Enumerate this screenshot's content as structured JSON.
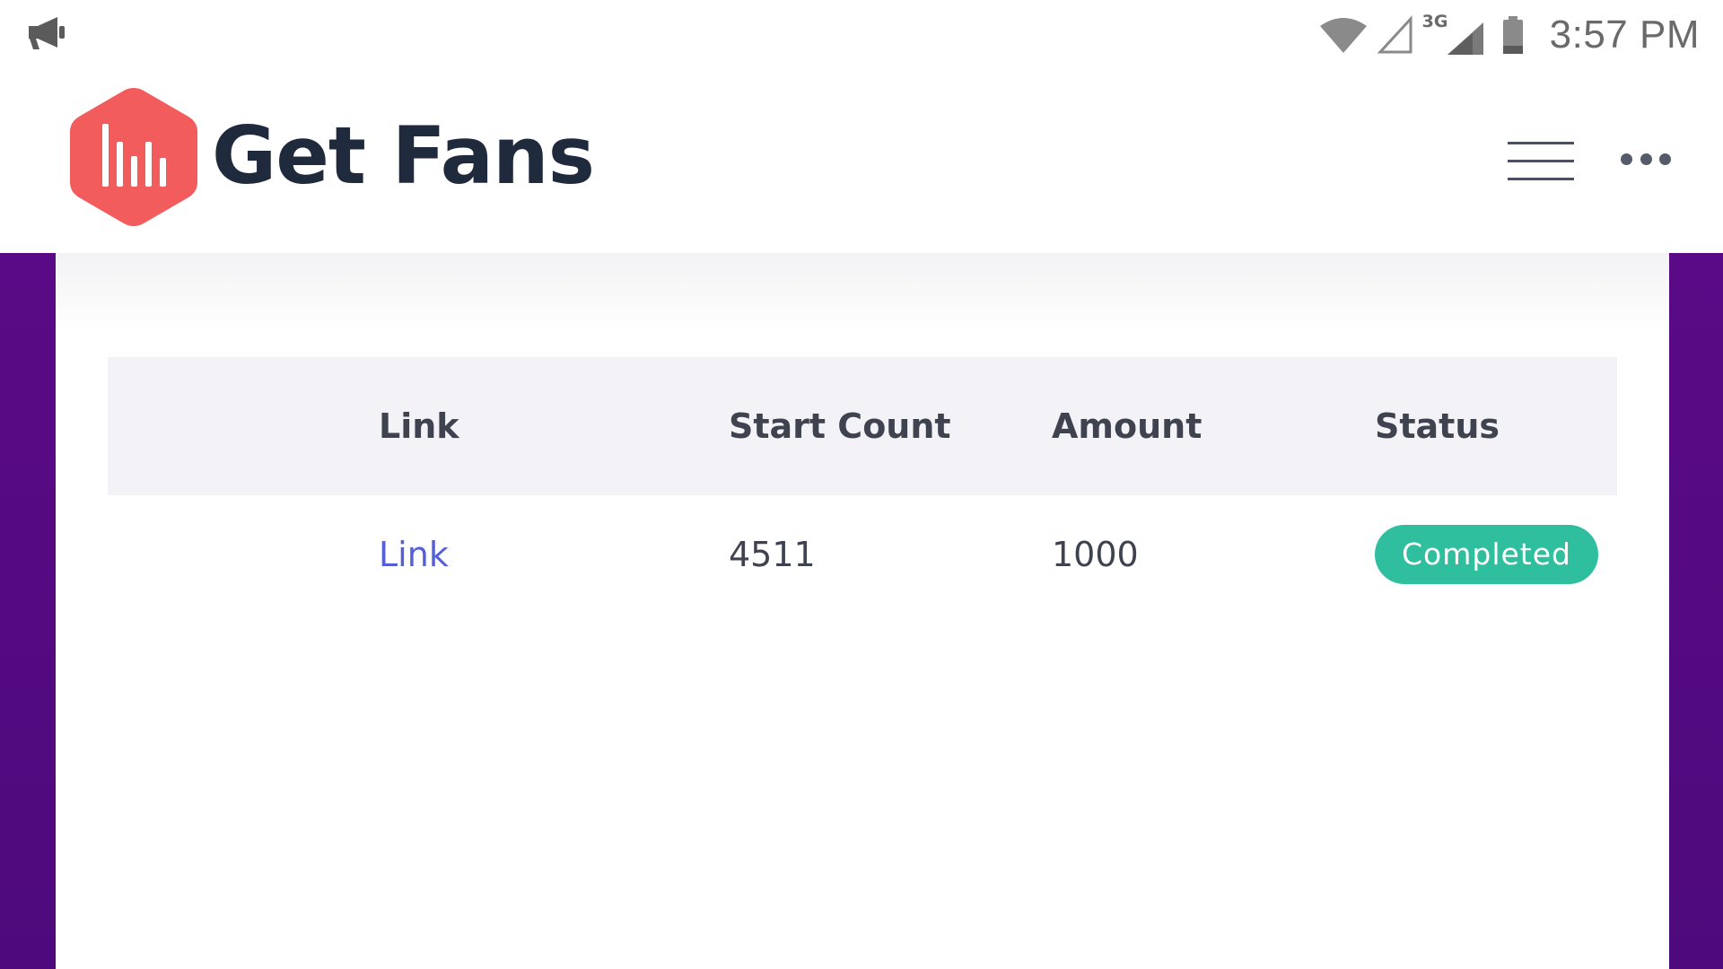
{
  "status_bar": {
    "time": "3:57 PM",
    "network_label": "3G",
    "icons": [
      "megaphone-icon",
      "wifi-icon",
      "signal-empty-icon",
      "signal-3g-icon",
      "battery-icon"
    ]
  },
  "header": {
    "app_name": "Get Fans",
    "logo_icon": "bar-chart-hexagon-icon",
    "menu_icon": "hamburger-menu-icon",
    "more_icon": "more-options-icon"
  },
  "table": {
    "columns": [
      "Link",
      "Start Count",
      "Amount",
      "Status"
    ],
    "rows": [
      {
        "link": "Link",
        "start_count": "4511",
        "amount": "1000",
        "status": "Completed"
      }
    ]
  },
  "colors": {
    "brand_red": "#f25c5c",
    "purple_backdrop": "#56098a",
    "status_completed": "#2fbf9e",
    "link_blue": "#5560d8",
    "logo_text": "#1f2a3c"
  }
}
